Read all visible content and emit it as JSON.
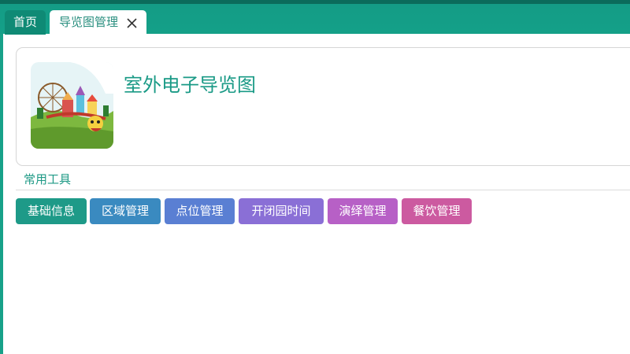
{
  "tabs": {
    "home_label": "首页",
    "active_label": "导览图管理"
  },
  "card": {
    "title": "室外电子导览图",
    "thumbnail_icon": "amusement-park-illustration"
  },
  "tools": {
    "section_label": "常用工具",
    "buttons": [
      {
        "label": "基础信息",
        "color": "#1e9a88"
      },
      {
        "label": "区域管理",
        "color": "#3a8ac0"
      },
      {
        "label": "点位管理",
        "color": "#5a7fd3"
      },
      {
        "label": "开闭园时间",
        "color": "#8a6fd6"
      },
      {
        "label": "演绎管理",
        "color": "#b760c6"
      },
      {
        "label": "餐饮管理",
        "color": "#cc5aa0"
      }
    ]
  },
  "colors": {
    "accent": "#149c86",
    "title": "#1a9a86"
  }
}
